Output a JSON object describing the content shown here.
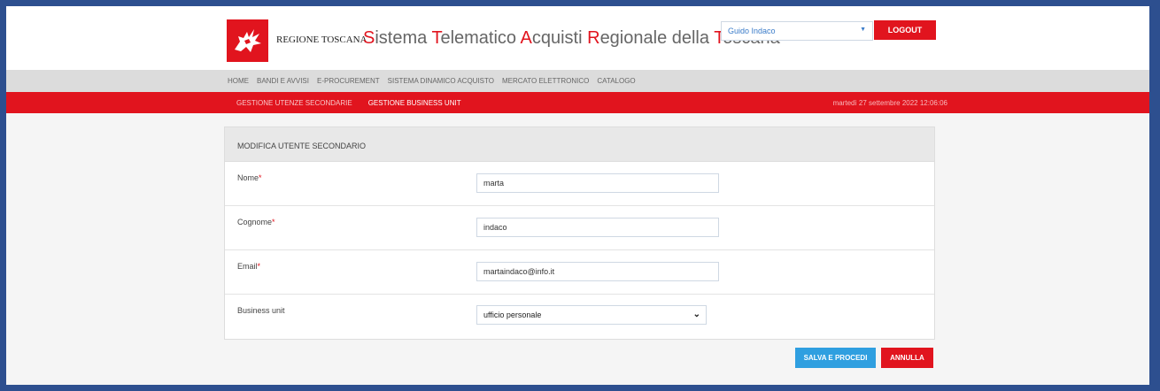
{
  "header": {
    "region_name": "REGIONE TOSCANA",
    "system_title": [
      {
        "cap": "S",
        "rest": "istema "
      },
      {
        "cap": "T",
        "rest": "elematico "
      },
      {
        "cap": "A",
        "rest": "cquisti "
      },
      {
        "cap": "R",
        "rest": "egionale della "
      },
      {
        "cap": "T",
        "rest": "oscana"
      }
    ],
    "user_name": "Guido Indaco",
    "logout_label": "LOGOUT"
  },
  "nav": {
    "items": [
      "HOME",
      "BANDI E AVVISI",
      "E-PROCUREMENT",
      "SISTEMA DINAMICO ACQUISTO",
      "MERCATO ELETTRONICO",
      "CATALOGO"
    ]
  },
  "subnav": {
    "items": [
      "GESTIONE UTENZE SECONDARIE",
      "GESTIONE BUSINESS UNIT"
    ],
    "datetime": "martedì 27 settembre 2022 12:06:06"
  },
  "form": {
    "title": "MODIFICA UTENTE SECONDARIO",
    "nome_label": "Nome",
    "nome_value": "marta",
    "cognome_label": "Cognome",
    "cognome_value": "indaco",
    "email_label": "Email",
    "email_value": "martaindaco@info.it",
    "bu_label": "Business unit",
    "bu_value": "ufficio personale",
    "required_mark": "*"
  },
  "actions": {
    "save_label": "SALVA E PROCEDI",
    "cancel_label": "ANNULLA"
  },
  "colors": {
    "accent_red": "#e1141e",
    "accent_blue": "#2f9fe0",
    "frame_border": "#2d4f8f"
  },
  "icons": {
    "logo": "pegasus-logo-icon",
    "user_caret": "caret-down-icon",
    "select_chevron": "chevron-down-icon"
  }
}
